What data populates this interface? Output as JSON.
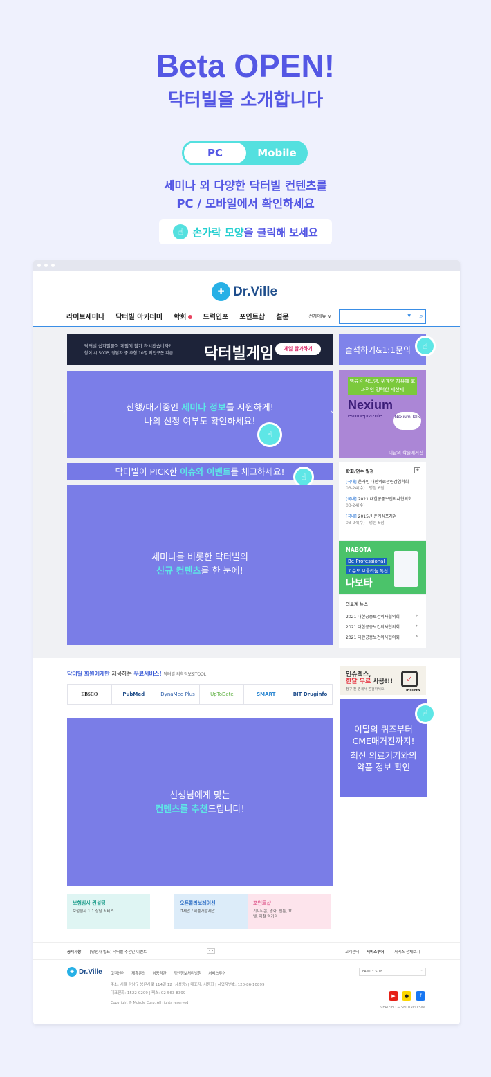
{
  "hero": {
    "title": "Beta OPEN!",
    "subtitle": "닥터빌을 소개합니다",
    "toggle_pc": "PC",
    "toggle_mobile": "Mobile",
    "desc_line1": "세미나 외 다양한 닥터빌 컨텐츠를",
    "desc_line2": "PC / 모바일에서 확인하세요",
    "hint_highlight": "손가락 모양",
    "hint_rest": "을 클릭해 보세요"
  },
  "site": {
    "logo": "Dr.Ville",
    "nav": [
      "라이브세미나",
      "닥터빌 아카데미",
      "학회",
      "드럭인포",
      "포인트샵",
      "설문"
    ],
    "all_menu": "전체메뉴",
    "search_placeholder": ""
  },
  "game_banner": {
    "line1": "닥터빌 십자말풀이 게임에 참가 하시겠습니까?",
    "line2": "참여 시 500P, 정답자 중 추첨 10명 지인쿠폰 지급",
    "title": "닥터빌게임",
    "button": "게임 참가하기"
  },
  "checkin": "출석하기&1:1문의",
  "overlays": {
    "seminar_a": "진행/대기중인 ",
    "seminar_b": "세미나 정보",
    "seminar_c": "를 시원하게!",
    "seminar_d": "나의 신청 여부도 확인하세요!",
    "pick_a": "닥터빌이 PICK한 ",
    "pick_b": "이슈와 이벤트",
    "pick_c": "를 체크하세요!",
    "content_a": "세미나를 비롯한 닥터빌의",
    "content_b": "신규 컨텐츠",
    "content_c": "를 한 눈에!",
    "recommend_a": "선생님에게 맞는",
    "recommend_b": "컨텐츠를 추천",
    "recommend_c": "드립니다!",
    "cme_a": "이달의 퀴즈부터",
    "cme_b": "CME매거진까지!",
    "cme_c": "최신 의료기기와의",
    "cme_d": "약품 정보 확인"
  },
  "nexium": {
    "tag": "역류성 식도염, 위궤양 치유에 효과적인 강력한 제산제",
    "brand": "Nexium",
    "generic": "esomeprazole",
    "bubble": "Nexium Talk",
    "footer": "이달의 학술매거진"
  },
  "conferences": {
    "header": "학회/연수 일정",
    "items": [
      {
        "tag": "[국내]",
        "name": "온라인 대한의료관련감염학회",
        "date": "03-24(수) | 평점 6점"
      },
      {
        "tag": "[국내]",
        "name": "2021 대한공중보건의사협의회",
        "date": "03-24(수)"
      },
      {
        "tag": "[국내]",
        "name": "2015년 춘계심포지엄",
        "date": "03-24(수) | 평점 6점"
      }
    ]
  },
  "nabota": {
    "brand": "NABOTA",
    "pro": "Be Professional",
    "line": "고순도 보툴리눔 톡신",
    "name": "나보타"
  },
  "news": {
    "header": "의료계 뉴스",
    "items": [
      "2021 대한공중보건의사협의회",
      "2021 대한공중보건의사협의회",
      "2021 대한공중보건의사협의회"
    ]
  },
  "free_services": {
    "header_a": "닥터빌 회원에게만 ",
    "header_b": "제공하는 ",
    "header_c": "무료서비스!",
    "header_d": "닥터빌 의학정보&TOOL",
    "items": [
      "EBSCO",
      "PubMed",
      "DynaMed Plus",
      "UpToDate",
      "SMART",
      "BIT Druginfo"
    ]
  },
  "insurex": {
    "line1": "인슈렉스,",
    "line2_red": "한달 무료",
    "line2_rest": " 사용!!!",
    "line3": "청구 전 명세서 점검하세요.",
    "logo": "InsurEx"
  },
  "cards": [
    {
      "title": "보험심사 컨설팅",
      "desc": "보험심사 1:1 상담 서비스"
    },
    {
      "title": "오픈콜라보레이션",
      "desc": "IT제안 / 제품개발제안"
    },
    {
      "title": "포인트샵",
      "desc": "기프티콘, 영화, 웹툰, 호텔, 제철 먹거리"
    }
  ],
  "footer": {
    "notice_label": "공지사항",
    "notice_text": "[당첨자 발표] 닥터빌 추천인 이벤트",
    "links_right": [
      "고객센터",
      "서비스투어",
      "서비스 전체보기"
    ],
    "links": [
      "고객센터",
      "제휴문의",
      "이용약관",
      "개인정보처리방침",
      "서비스투어"
    ],
    "address": "주소: 서울 강남구 봉은사로 114길 12 (삼성동) | 대표자: 서동회 | 사업자번호: 120-86-10899",
    "phone": "대표전화: 1522-0209 | 팩스: 02-563-8399",
    "copyright": "Copyright © Mcircle Corp. All rights reserved",
    "family_site": "FAMILY SITE",
    "verified": "VERIFIED & SECURED Site"
  }
}
